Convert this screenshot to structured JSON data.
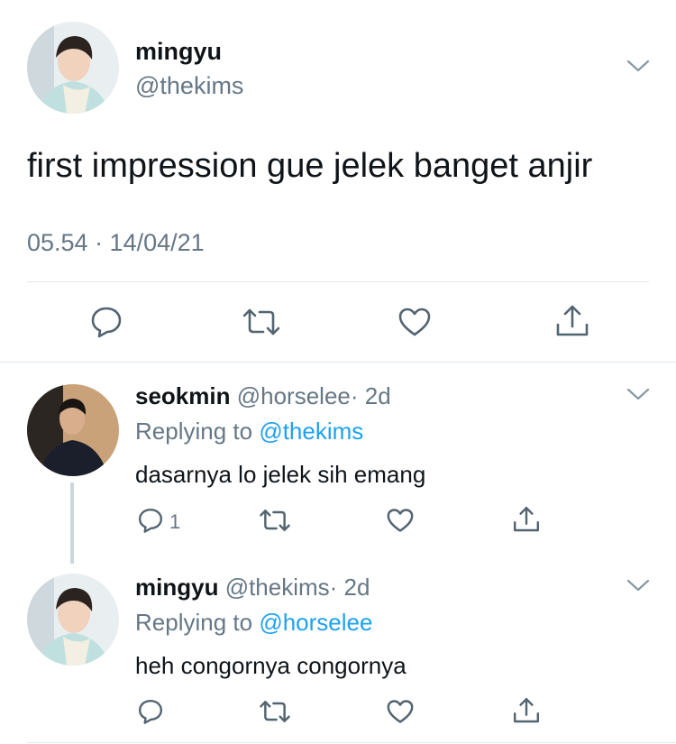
{
  "main_tweet": {
    "display_name": "mingyu",
    "handle": "@thekims",
    "text": "first impression gue jelek banget anjir",
    "timestamp": "05.54 · 14/04/21"
  },
  "replies": [
    {
      "display_name": "seokmin",
      "handle": "@horselee",
      "age": "· 2d",
      "replying_label": "Replying to",
      "replying_handle": "@thekims",
      "text": "dasarnya lo jelek sih emang",
      "reply_count": "1"
    },
    {
      "display_name": "mingyu",
      "handle": "@thekims",
      "age": "· 2d",
      "replying_label": "Replying to",
      "replying_handle": "@horselee",
      "text": "heh congornya congornya"
    }
  ],
  "colors": {
    "text": "#0f1419",
    "muted": "#657786",
    "link": "#1da1f2",
    "icon": "#536471"
  }
}
